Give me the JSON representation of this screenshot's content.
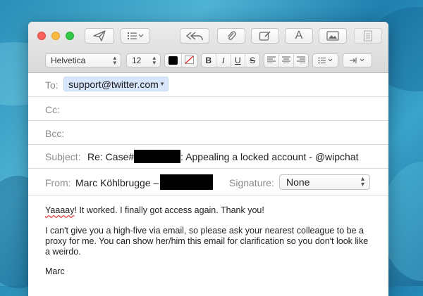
{
  "toolbar": {
    "send": "paper-plane-icon",
    "header_fields": "list-icon",
    "reply": "reply-all-icon",
    "attach": "paperclip-icon",
    "markup": "markup-icon",
    "font_label": "A",
    "photo": "photo-icon",
    "template": "template-icon"
  },
  "format_bar": {
    "font": "Helvetica",
    "size": "12",
    "bold": "B",
    "italic": "I",
    "underline": "U",
    "strike": "S",
    "text_color": "#000000"
  },
  "fields": {
    "to_label": "To:",
    "to_value": "support@twitter.com",
    "cc_label": "Cc:",
    "bcc_label": "Bcc:",
    "subject_label": "Subject:",
    "subject_prefix": "Re: Case#",
    "subject_suffix": ": Appealing a locked account - @wipchat",
    "from_label": "From:",
    "from_value": "Marc Köhlbrugge –",
    "signature_label": "Signature:",
    "signature_value": "None"
  },
  "body": {
    "line1_word": "Yaaaay",
    "line1_rest": "! It worked. I finally got access again. Thank you!",
    "para2_line1": "I can't give you a high-five via email, so please ask your nearest colleague to be a",
    "para2_line2": "proxy for me. You can show her/him this email for clarification so you don't look like",
    "para2_line3": "a weirdo.",
    "signoff": "Marc"
  }
}
